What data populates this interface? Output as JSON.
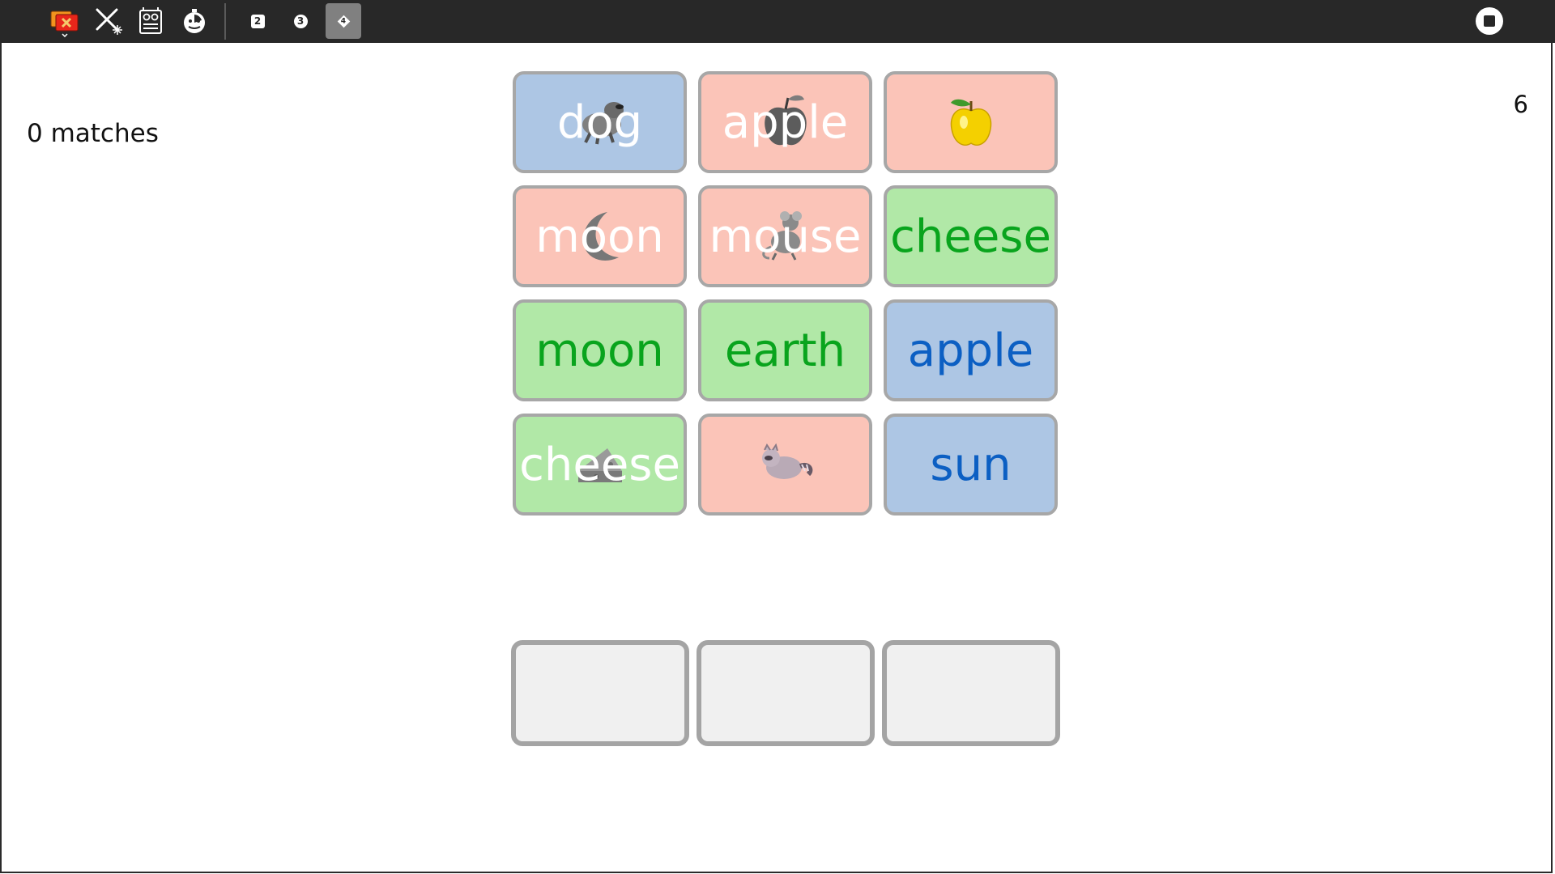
{
  "toolbar": {
    "icons": [
      "activity-cards-icon",
      "tools-icon",
      "robot-icon",
      "timer-icon",
      "stop-icon"
    ],
    "levels": [
      {
        "label": "2",
        "active": false
      },
      {
        "label": "3",
        "active": false
      },
      {
        "label": "4",
        "active": true
      }
    ]
  },
  "status": {
    "matches": "0 matches",
    "count": "6"
  },
  "cards": [
    {
      "word": "dog",
      "color": "blue",
      "image": "dog-icon"
    },
    {
      "word": "apple",
      "color": "pink",
      "image": "gray-apple-icon"
    },
    {
      "word": "",
      "color": "pink",
      "image": "yellow-apple-icon"
    },
    {
      "word": "moon",
      "color": "pink",
      "image": "moon-icon"
    },
    {
      "word": "mouse",
      "color": "pink",
      "image": "mouse-icon"
    },
    {
      "word": "cheese",
      "color": "green",
      "image": ""
    },
    {
      "word": "moon",
      "color": "green",
      "image": ""
    },
    {
      "word": "earth",
      "color": "green",
      "image": ""
    },
    {
      "word": "apple",
      "color": "blue",
      "image": ""
    },
    {
      "word": "cheese",
      "color": "green",
      "image": "cheese-icon"
    },
    {
      "word": "",
      "color": "pink",
      "image": "raccoon-icon"
    },
    {
      "word": "sun",
      "color": "blue",
      "image": ""
    }
  ],
  "colors": {
    "toolbar": "#282828",
    "card_blue": "#adc6e4",
    "card_pink": "#fbc4b8",
    "card_green": "#b1e8a7",
    "text_green": "#09a41d",
    "text_blue": "#0c5fc3",
    "accent_red": "#e8261a",
    "accent_orange": "#f2931e"
  }
}
